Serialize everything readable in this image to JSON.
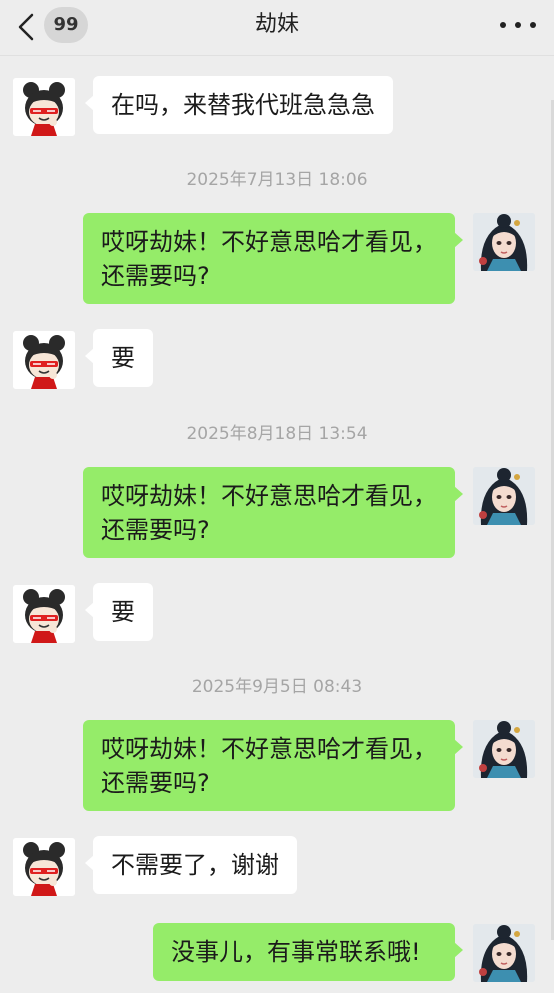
{
  "header": {
    "unread_count": "99",
    "title": "劫妹"
  },
  "messages": [
    {
      "side": "left",
      "text": "在吗，来替我代班急急急"
    },
    {
      "timestamp": "2025年7月13日 18:06"
    },
    {
      "side": "right",
      "text": "哎呀劫妹！不好意思哈才看见，还需要吗?"
    },
    {
      "side": "left",
      "text": "要"
    },
    {
      "timestamp": "2025年8月18日 13:54"
    },
    {
      "side": "right",
      "text": "哎呀劫妹！不好意思哈才看见，还需要吗?"
    },
    {
      "side": "left",
      "text": "要"
    },
    {
      "timestamp": "2025年9月5日 08:43"
    },
    {
      "side": "right",
      "text": "哎呀劫妹！不好意思哈才看见，还需要吗?"
    },
    {
      "side": "left",
      "text": "不需要了，谢谢"
    },
    {
      "side": "right",
      "text": "没事儿，有事常联系哦!"
    }
  ],
  "colors": {
    "background": "#ededed",
    "sent_bubble": "#95ec69",
    "received_bubble": "#ffffff",
    "timestamp": "#a5a5a5"
  },
  "icons": {
    "back": "chevron-left-icon",
    "more": "more-dots-icon",
    "contact_avatar": "cartoon-girl-avatar",
    "self_avatar": "anime-girl-avatar"
  }
}
